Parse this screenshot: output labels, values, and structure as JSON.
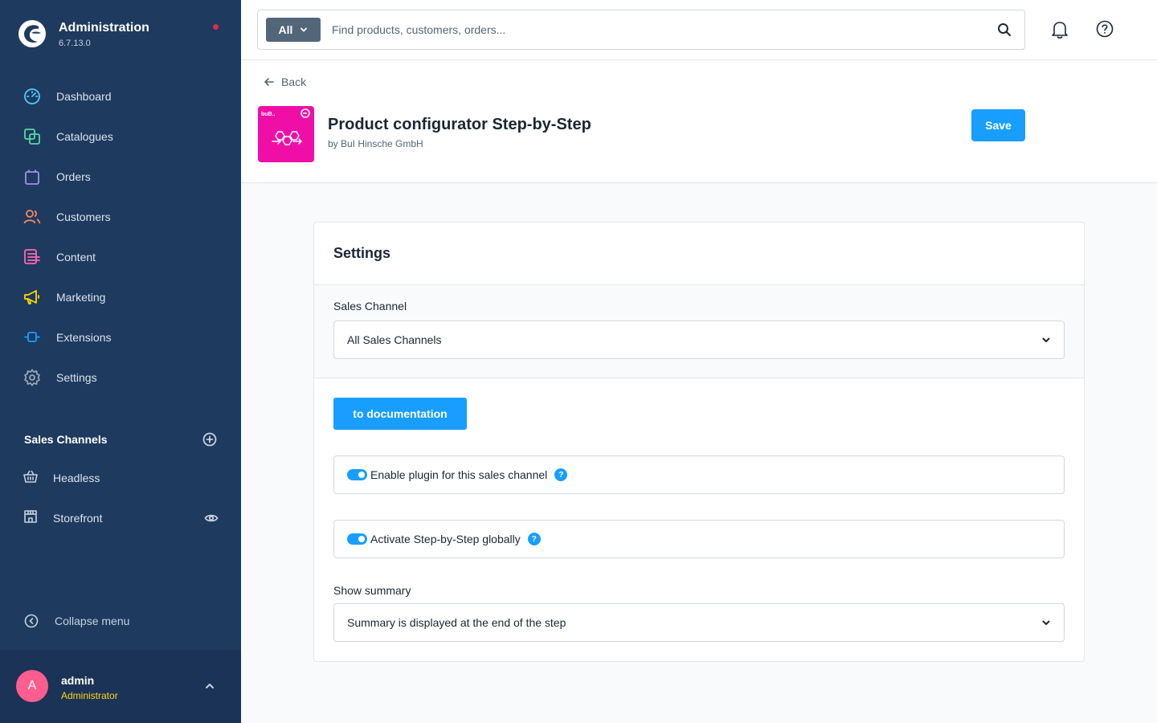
{
  "brand": {
    "title": "Administration",
    "version": "6.7.13.0"
  },
  "nav": [
    {
      "label": "Dashboard",
      "icon": "dashboard-icon",
      "color": "#54c9ff"
    },
    {
      "label": "Catalogues",
      "icon": "catalogues-icon",
      "color": "#57d9a3"
    },
    {
      "label": "Orders",
      "icon": "orders-icon",
      "color": "#a092f0"
    },
    {
      "label": "Customers",
      "icon": "customers-icon",
      "color": "#f88962"
    },
    {
      "label": "Content",
      "icon": "content-icon",
      "color": "#ff68b4"
    },
    {
      "label": "Marketing",
      "icon": "marketing-icon",
      "color": "#ffd700"
    },
    {
      "label": "Extensions",
      "icon": "extensions-icon",
      "color": "#189eff"
    },
    {
      "label": "Settings",
      "icon": "settings-icon",
      "color": "#9aa8b5"
    }
  ],
  "sales_channels": {
    "title": "Sales Channels",
    "items": [
      {
        "label": "Headless",
        "icon": "basket-icon"
      },
      {
        "label": "Storefront",
        "icon": "storefront-icon"
      }
    ]
  },
  "collapse_label": "Collapse menu",
  "user": {
    "initial": "A",
    "name": "admin",
    "role": "Administrator"
  },
  "search": {
    "type": "All",
    "placeholder": "Find products, customers, orders..."
  },
  "header": {
    "back": "Back",
    "title": "Product configurator Step-by-Step",
    "by": "by BuI Hinsche GmbH",
    "save": "Save"
  },
  "card": {
    "title": "Settings",
    "sales_channel_label": "Sales Channel",
    "sales_channel_value": "All Sales Channels",
    "doc_button": "to documentation",
    "toggle1": "Enable plugin for this sales channel",
    "toggle2": "Activate Step-by-Step globally",
    "summary_label": "Show summary",
    "summary_value": "Summary is displayed at the end of the step"
  },
  "logo_text": "buB.."
}
